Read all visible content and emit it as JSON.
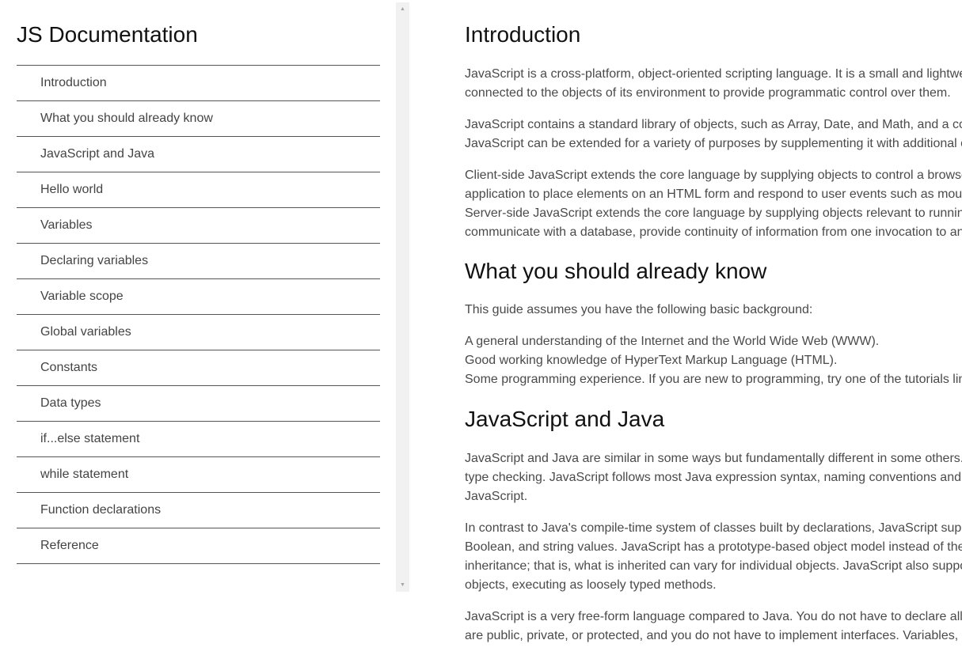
{
  "sidebar": {
    "title": "JS Documentation",
    "items": [
      {
        "label": "Introduction"
      },
      {
        "label": "What you should already know"
      },
      {
        "label": "JavaScript and Java"
      },
      {
        "label": "Hello world"
      },
      {
        "label": "Variables"
      },
      {
        "label": "Declaring variables"
      },
      {
        "label": "Variable scope"
      },
      {
        "label": "Global variables"
      },
      {
        "label": "Constants"
      },
      {
        "label": "Data types"
      },
      {
        "label": "if...else statement"
      },
      {
        "label": "while statement"
      },
      {
        "label": "Function declarations"
      },
      {
        "label": "Reference"
      }
    ]
  },
  "colors": {
    "text": "#444444",
    "heading": "#111111",
    "divider": "#555555",
    "scrollbar_track": "#f1f1f1"
  },
  "main": {
    "sections": [
      {
        "title": "Introduction",
        "paragraphs": [
          [
            "JavaScript is a cross-platform, object-oriented scripting language. It is a small and lightwe",
            "connected to the objects of its environment to provide programmatic control over them."
          ],
          [
            "JavaScript contains a standard library of objects, such as Array, Date, and Math, and a co",
            "JavaScript can be extended for a variety of purposes by supplementing it with additional o"
          ],
          [
            "Client-side JavaScript extends the core language by supplying objects to control a browse",
            "application to place elements on an HTML form and respond to user events such as mous",
            "Server-side JavaScript extends the core language by supplying objects relevant to running",
            "communicate with a database, provide continuity of information from one invocation to an"
          ]
        ]
      },
      {
        "title": "What you should already know",
        "paragraphs": [
          [
            "This guide assumes you have the following basic background:"
          ],
          [
            "A general understanding of the Internet and the World Wide Web (WWW).",
            "Good working knowledge of HyperText Markup Language (HTML).",
            "Some programming experience. If you are new to programming, try one of the tutorials lin"
          ]
        ]
      },
      {
        "title": "JavaScript and Java",
        "paragraphs": [
          [
            "JavaScript and Java are similar in some ways but fundamentally different in some others.",
            "type checking. JavaScript follows most Java expression syntax, naming conventions and",
            "JavaScript."
          ],
          [
            "In contrast to Java's compile-time system of classes built by declarations, JavaScript sup",
            "Boolean, and string values. JavaScript has a prototype-based object model instead of the",
            "inheritance; that is, what is inherited can vary for individual objects. JavaScript also suppo",
            "objects, executing as loosely typed methods."
          ],
          [
            "JavaScript is a very free-form language compared to Java. You do not have to declare all",
            "are public, private, or protected, and you do not have to implement interfaces. Variables,"
          ]
        ]
      }
    ]
  }
}
